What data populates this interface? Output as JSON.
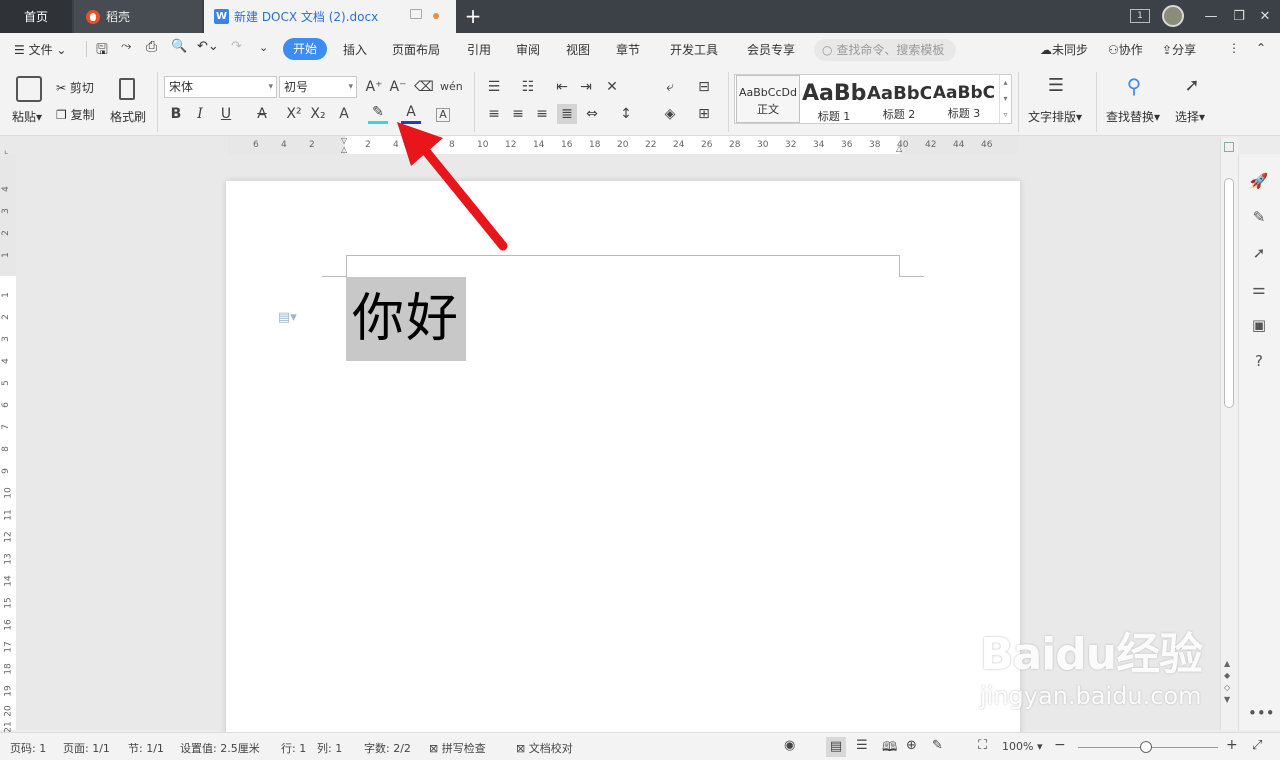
{
  "tabs": {
    "home": "首页",
    "daoke": "稻壳",
    "doc": "新建 DOCX 文档 (2).docx",
    "doc_icon": "W"
  },
  "menu": {
    "file": "文件",
    "start": "开始",
    "items": [
      "插入",
      "页面布局",
      "引用",
      "审阅",
      "视图",
      "章节",
      "开发工具",
      "会员专享"
    ],
    "search_placeholder": "查找命令、搜索模板",
    "unsync": "未同步",
    "collab": "协作",
    "share": "分享"
  },
  "ribbon": {
    "paste": "粘贴",
    "cut": "剪切",
    "copy": "复制",
    "format_painter": "格式刷",
    "font_name": "宋体",
    "font_size": "初号",
    "styles": [
      {
        "preview": "AaBbCcDd",
        "label": "正文"
      },
      {
        "preview": "AaBb",
        "label": "标题 1"
      },
      {
        "preview": "AaBbC",
        "label": "标题 2"
      },
      {
        "preview": "AaBbC",
        "label": "标题 3"
      }
    ],
    "text_layout": "文字排版",
    "find_replace": "查找替换",
    "select": "选择"
  },
  "ruler": {
    "top": [
      "6",
      "4",
      "2",
      "2",
      "4",
      "8",
      "10",
      "12",
      "14",
      "16",
      "18",
      "20",
      "22",
      "24",
      "26",
      "28",
      "30",
      "32",
      "34",
      "36",
      "38",
      "40",
      "42",
      "44",
      "46"
    ],
    "left": [
      "4",
      "3",
      "2",
      "1",
      "1",
      "2",
      "3",
      "4",
      "5",
      "6",
      "7",
      "8",
      "9",
      "10",
      "11",
      "12",
      "13",
      "14",
      "15",
      "16",
      "17",
      "18",
      "19",
      "20",
      "21"
    ]
  },
  "document": {
    "content": "你好"
  },
  "status": {
    "page": "页码: 1",
    "pages": "页面: 1/1",
    "section": "节: 1/1",
    "setting": "设置值: 2.5厘米",
    "row": "行: 1",
    "col": "列: 1",
    "words": "字数: 2/2",
    "spell": "拼写检查",
    "proof": "文档校对",
    "zoom": "100%"
  },
  "watermark": {
    "brand": "Baidu经验",
    "url": "jingyan.baidu.com"
  },
  "colors": {
    "accent": "#3c8cf1",
    "titlebar": "#3c4147",
    "arrow": "#e8161b"
  }
}
